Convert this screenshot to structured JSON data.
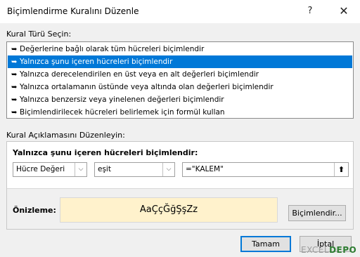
{
  "window": {
    "title": "Biçimlendirme Kuralını Düzenle",
    "help_glyph": "?",
    "close_glyph": "✕"
  },
  "rule_type": {
    "label": "Kural Türü Seçin:",
    "items": [
      {
        "text": "Değerlerine bağlı olarak tüm hücreleri biçimlendir",
        "selected": false
      },
      {
        "text": "Yalnızca şunu içeren hücreleri biçimlendir",
        "selected": true
      },
      {
        "text": "Yalnızca derecelendirilen en üst veya en alt değerleri biçimlendir",
        "selected": false
      },
      {
        "text": "Yalnızca ortalamanın üstünde veya altında olan değerleri biçimlendir",
        "selected": false
      },
      {
        "text": "Yalnızca benzersiz veya yinelenen değerleri biçimlendir",
        "selected": false
      },
      {
        "text": "Biçimlendirilecek hücreleri belirlemek için formül kullan",
        "selected": false
      }
    ],
    "item_icon": "arrow-right-icon"
  },
  "description": {
    "label": "Kural Açıklamasını Düzenleyin:",
    "heading": "Yalnızca şunu içeren hücreleri biçimlendir:",
    "condition_type": "Hücre Değeri",
    "operator": "eşit",
    "value": "=\"KALEM\""
  },
  "preview": {
    "label": "Önizleme:",
    "sample": "AaÇçĞğŞşZz",
    "format_button": "Biçimlendir...",
    "background": "#fff2cc"
  },
  "footer": {
    "ok": "Tamam",
    "cancel": "İptal"
  },
  "watermark": {
    "part1": "EXCEL",
    "part2": "DEPO"
  },
  "colors": {
    "selection": "#0078d7",
    "default_button_border": "#0078d7"
  }
}
